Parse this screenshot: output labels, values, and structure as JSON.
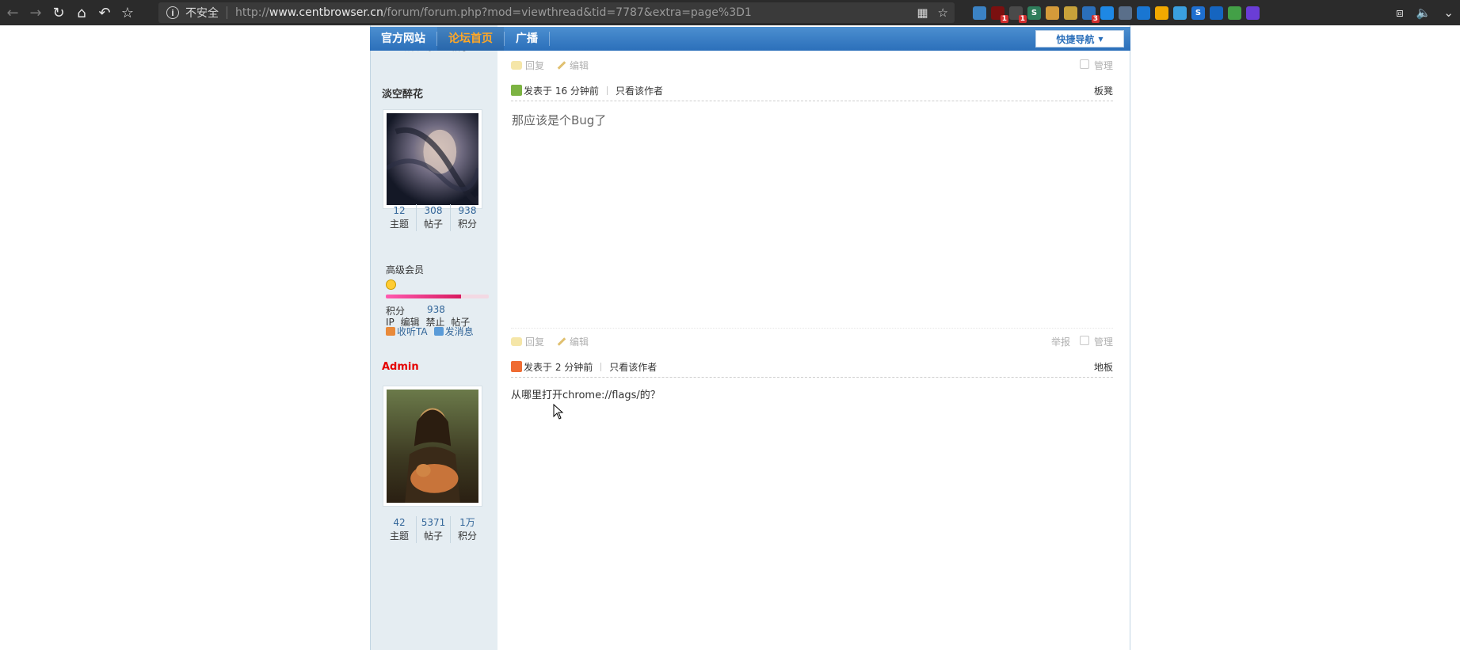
{
  "browser": {
    "secure_label": "不安全",
    "url_prefix": "http://",
    "url_domain": "www.centbrowser.cn",
    "url_path": "/forum/forum.php?mod=viewthread&tid=7787&extra=page%3D1",
    "extensions": [
      {
        "name": "translate",
        "color": "#3b82c4",
        "glyph": "",
        "badge": ""
      },
      {
        "name": "ublock",
        "color": "#7a1010",
        "glyph": "",
        "badge": "1"
      },
      {
        "name": "extension-b",
        "color": "#4a4a4a",
        "glyph": "",
        "badge": "1"
      },
      {
        "name": "stylus",
        "color": "#2e7d5b",
        "glyph": "S",
        "badge": ""
      },
      {
        "name": "cookie",
        "color": "#d49a3a",
        "glyph": "",
        "badge": ""
      },
      {
        "name": "key",
        "color": "#c7a23a",
        "glyph": "",
        "badge": ""
      },
      {
        "name": "drop",
        "color": "#2b6fba",
        "glyph": "",
        "badge": "3"
      },
      {
        "name": "chat",
        "color": "#1e88e5",
        "glyph": "",
        "badge": ""
      },
      {
        "name": "user",
        "color": "#5a6f8a",
        "glyph": "",
        "badge": ""
      },
      {
        "name": "zh",
        "color": "#1976d2",
        "glyph": "",
        "badge": ""
      },
      {
        "name": "keeper",
        "color": "#f2a900",
        "glyph": "",
        "badge": ""
      },
      {
        "name": "cloud",
        "color": "#3aa0e0",
        "glyph": "",
        "badge": ""
      },
      {
        "name": "s-blue",
        "color": "#1e6fd0",
        "glyph": "S",
        "badge": ""
      },
      {
        "name": "wt",
        "color": "#1565c0",
        "glyph": "",
        "badge": ""
      },
      {
        "name": "globe",
        "color": "#43a047",
        "glyph": "",
        "badge": ""
      },
      {
        "name": "bolt",
        "color": "#6a3dd6",
        "glyph": "",
        "badge": ""
      }
    ]
  },
  "nav": {
    "items": [
      "官方网站",
      "论坛首页",
      "广播"
    ],
    "quick_nav": "快捷导航"
  },
  "common": {
    "ip": "IP",
    "edit": "编辑",
    "ban": "禁止",
    "posts_link": "帖子",
    "reply": "回复",
    "edit_action": "编辑",
    "manage": "管理",
    "report": "举报",
    "posted_prefix": "发表于",
    "only_author": "只看该作者",
    "topics_label": "主题",
    "posts_label": "帖子",
    "score_label": "积分",
    "follow": "收听TA",
    "message": "发消息"
  },
  "posts": [
    {
      "author": "淡空醉花",
      "is_admin": false,
      "topics": "12",
      "posts": "308",
      "score": "938",
      "rank": "高级会员",
      "rank_progress": 0.73,
      "time": "16 分钟前",
      "floor": "板凳",
      "content": "那应该是个Bug了"
    },
    {
      "author": "Admin",
      "is_admin": true,
      "topics": "42",
      "posts": "5371",
      "score": "1万",
      "time": "2 分钟前",
      "floor": "地板",
      "content": "从哪里打开chrome://flags/的？"
    }
  ]
}
